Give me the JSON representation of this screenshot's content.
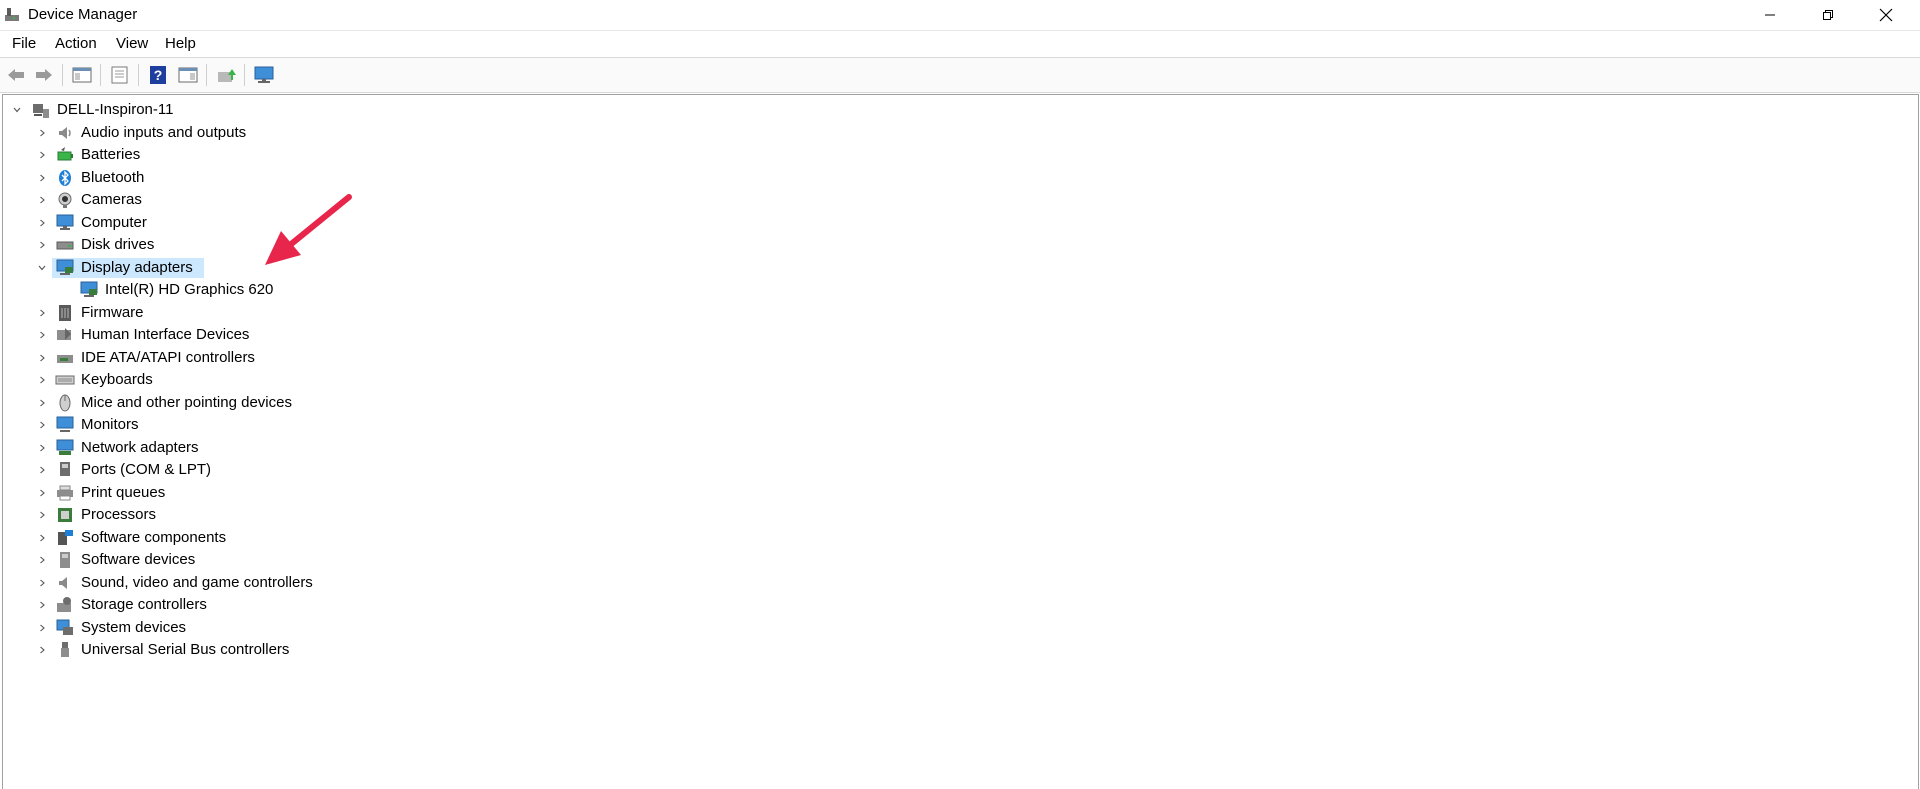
{
  "window": {
    "title": "Device Manager"
  },
  "menu": [
    "File",
    "Action",
    "View",
    "Help"
  ],
  "toolbar": {
    "buttons": [
      "back-icon",
      "forward-icon",
      "show-hide-console-tree-icon",
      "properties-icon",
      "help-icon",
      "action-pane-icon",
      "update-driver-icon",
      "scan-hardware-icon"
    ]
  },
  "tree": {
    "root": "DELL-Inspiron-11",
    "categories": [
      {
        "label": "Audio inputs and outputs",
        "icon": "speaker-icon"
      },
      {
        "label": "Batteries",
        "icon": "battery-icon"
      },
      {
        "label": "Bluetooth",
        "icon": "bluetooth-icon"
      },
      {
        "label": "Cameras",
        "icon": "camera-icon"
      },
      {
        "label": "Computer",
        "icon": "computer-icon"
      },
      {
        "label": "Disk drives",
        "icon": "disk-drive-icon"
      },
      {
        "label": "Display adapters",
        "icon": "display-adapter-icon",
        "expanded": true,
        "selected": true,
        "children": [
          "Intel(R) HD Graphics 620"
        ]
      },
      {
        "label": "Firmware",
        "icon": "firmware-icon"
      },
      {
        "label": "Human Interface Devices",
        "icon": "hid-icon"
      },
      {
        "label": "IDE ATA/ATAPI controllers",
        "icon": "ide-controller-icon"
      },
      {
        "label": "Keyboards",
        "icon": "keyboard-icon"
      },
      {
        "label": "Mice and other pointing devices",
        "icon": "mouse-icon"
      },
      {
        "label": "Monitors",
        "icon": "monitor-icon"
      },
      {
        "label": "Network adapters",
        "icon": "network-adapter-icon"
      },
      {
        "label": "Ports (COM & LPT)",
        "icon": "port-icon"
      },
      {
        "label": "Print queues",
        "icon": "printer-icon"
      },
      {
        "label": "Processors",
        "icon": "processor-icon"
      },
      {
        "label": "Software components",
        "icon": "software-component-icon"
      },
      {
        "label": "Software devices",
        "icon": "software-device-icon"
      },
      {
        "label": "Sound, video and game controllers",
        "icon": "sound-controller-icon"
      },
      {
        "label": "Storage controllers",
        "icon": "storage-controller-icon"
      },
      {
        "label": "System devices",
        "icon": "system-device-icon"
      },
      {
        "label": "Universal Serial Bus controllers",
        "icon": "usb-icon"
      }
    ]
  },
  "colors": {
    "selection": "#cce8ff",
    "annotation_arrow": "#e8254a",
    "accent": "#1e7fd6"
  }
}
